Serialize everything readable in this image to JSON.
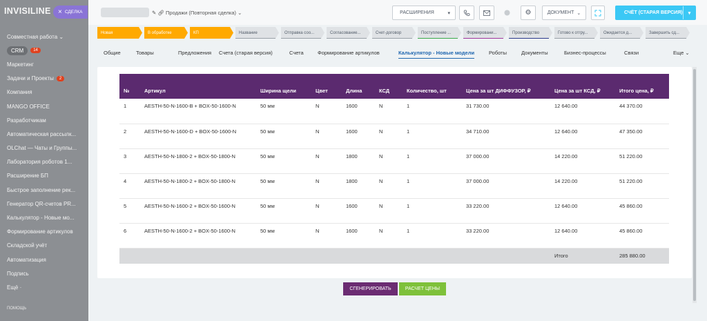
{
  "sidebar": {
    "logo": "INVISILINE",
    "deal_pill": "СДЕЛКА",
    "items": [
      {
        "label": "Совместная работа ⌄"
      },
      {
        "label": "CRM",
        "badge": "14"
      },
      {
        "label": "Маркетинг"
      },
      {
        "label": "Задачи и Проекты",
        "badge": "2"
      },
      {
        "label": "Компания"
      },
      {
        "label": "MANGO OFFICE"
      },
      {
        "label": "Разработчикам"
      },
      {
        "label": "Автоматическая рассылк..."
      },
      {
        "label": "OLChat — Чаты и Группы..."
      },
      {
        "label": "Лаборатория роботов 1..."
      },
      {
        "label": "Расширение БП"
      },
      {
        "label": "Быстрое заполнение рек..."
      },
      {
        "label": "Генератор QR-счетов PR..."
      },
      {
        "label": "Калькулятор - Новые мо..."
      },
      {
        "label": "Формирование артикулов"
      },
      {
        "label": "Складской учёт"
      },
      {
        "label": "Автоматизация"
      },
      {
        "label": "Подпись"
      },
      {
        "label": "Ещё ·"
      }
    ],
    "footer": "ПОМОЩЬ"
  },
  "header": {
    "deal_subtitle": "Продажи (Повторная сделка) ⌄",
    "extensions": "РАСШИРЕНИЯ",
    "document": "ДОКУМЕНТ",
    "invoice": "СЧЁТ (СТАРАЯ ВЕРСИЯ)"
  },
  "stages": [
    {
      "label": "Новая",
      "active": true
    },
    {
      "label": "В обработке",
      "active": true
    },
    {
      "label": "КП",
      "active": true
    },
    {
      "label": "Название",
      "active": false,
      "color": "#9aa1a8"
    },
    {
      "label": "Отправка соо...",
      "active": false,
      "color": "#9aa1a8"
    },
    {
      "label": "Согласование...",
      "active": false,
      "color": "#9aa1a8"
    },
    {
      "label": "Счет-договор",
      "active": false,
      "color": "#9aa1a8"
    },
    {
      "label": "Поступление ...",
      "active": false,
      "color": "#3aaa4a"
    },
    {
      "label": "Формировани...",
      "active": false,
      "color": "#a0379c"
    },
    {
      "label": "Производство",
      "active": false,
      "color": "#2d3a8c"
    },
    {
      "label": "Готово к отгру...",
      "active": false,
      "color": "#9aa1a8"
    },
    {
      "label": "Ожидается д...",
      "active": false,
      "color": "#9aa1a8"
    },
    {
      "label": "Завершить сд...",
      "active": false,
      "color": "#9aa1a8"
    }
  ],
  "tabs": [
    {
      "label": "Общие"
    },
    {
      "label": "Товары"
    },
    {
      "label": "Предложения"
    },
    {
      "label": "Счета (старая версия)"
    },
    {
      "label": "Счета"
    },
    {
      "label": "Формирование артикулов"
    },
    {
      "label": "Калькулятор - Новые модели",
      "active": true
    },
    {
      "label": "Роботы"
    },
    {
      "label": "Документы"
    },
    {
      "label": "Бизнес-процессы"
    },
    {
      "label": "Связи"
    },
    {
      "label": "Еще ⌄"
    }
  ],
  "table": {
    "headers": [
      "№",
      "Артикул",
      "Ширина щели",
      "Цвет",
      "Длина",
      "КСД",
      "Количество, шт",
      "Цена за шт ДИФФУЗОР, ₽",
      "Цена за шт КСД, ₽",
      "Итого цена, ₽"
    ],
    "rows": [
      [
        "1",
        "AESTH-50-N-1600-B + BOX-50-1600-N",
        "50 мм",
        "N",
        "1600",
        "N",
        "1",
        "31 730.00",
        "12 640.00",
        "44 370.00"
      ],
      [
        "2",
        "AESTH-50-N-1600-D + BOX-50-1600-N",
        "50 мм",
        "N",
        "1600",
        "N",
        "1",
        "34 710.00",
        "12 640.00",
        "47 350.00"
      ],
      [
        "3",
        "AESTH-50-N-1800-2 + BOX-50-1800-N",
        "50 мм",
        "N",
        "1800",
        "N",
        "1",
        "37 000.00",
        "14 220.00",
        "51 220.00"
      ],
      [
        "4",
        "AESTH-50-N-1800-2 + BOX-50-1800-N",
        "50 мм",
        "N",
        "1800",
        "N",
        "1",
        "37 000.00",
        "14 220.00",
        "51 220.00"
      ],
      [
        "5",
        "AESTH-50-N-1600-2 + BOX-50-1600-N",
        "50 мм",
        "N",
        "1600",
        "N",
        "1",
        "33 220.00",
        "12 640.00",
        "45 860.00"
      ],
      [
        "6",
        "AESTH-50-N-1600-2 + BOX-50-1600-N",
        "50 мм",
        "N",
        "1600",
        "N",
        "1",
        "33 220.00",
        "12 640.00",
        "45 860.00"
      ]
    ],
    "total_label": "Итого",
    "total_value": "285 880.00"
  },
  "actions": {
    "generate": "СГЕНЕРИРОВАТЬ",
    "calc": "РАСЧЕТ ЦЕНЫ"
  },
  "colors": {
    "table_header": "#5b2a6f",
    "generate_button": "#6b2c72",
    "calc_button": "#7ec13a",
    "stage_active": "#ffa900",
    "primary": "#3bc8f5"
  }
}
